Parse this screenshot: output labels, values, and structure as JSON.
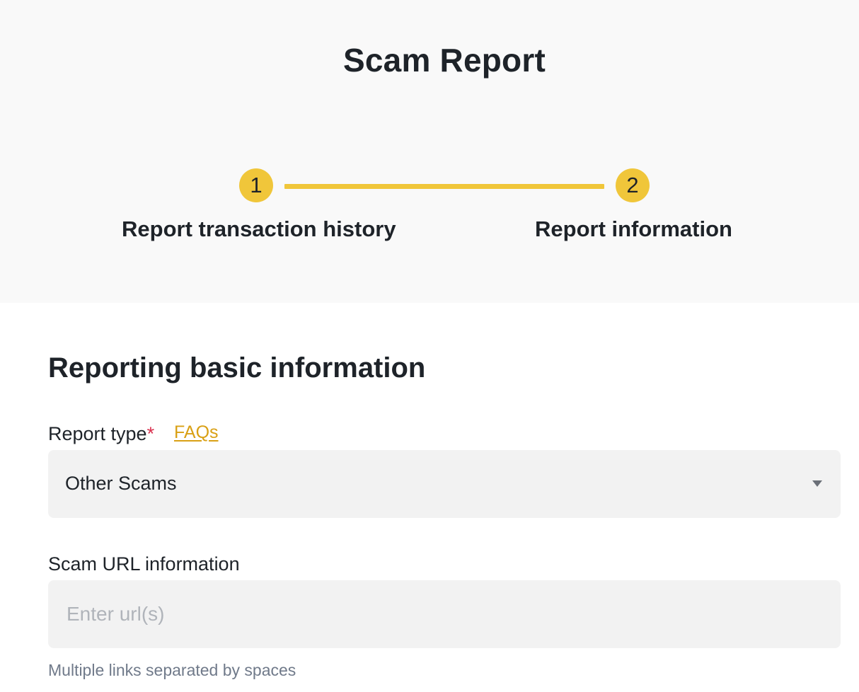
{
  "header": {
    "title": "Scam Report"
  },
  "stepper": {
    "steps": [
      {
        "number": "1",
        "label": "Report transaction history"
      },
      {
        "number": "2",
        "label": "Report information"
      }
    ]
  },
  "form": {
    "section_title": "Reporting basic information",
    "report_type": {
      "label": "Report type",
      "required_mark": "*",
      "faq_link": "FAQs",
      "selected": "Other Scams"
    },
    "scam_url": {
      "label": "Scam URL information",
      "placeholder": "Enter url(s)",
      "value": "",
      "helper": "Multiple links separated by spaces"
    }
  },
  "colors": {
    "accent": "#f0c63a",
    "link": "#d9a015",
    "required": "#d9304e",
    "hero_bg": "#f9f9f9",
    "input_bg": "#f2f2f2"
  },
  "icons": {
    "select_caret": "caret-down-icon"
  }
}
